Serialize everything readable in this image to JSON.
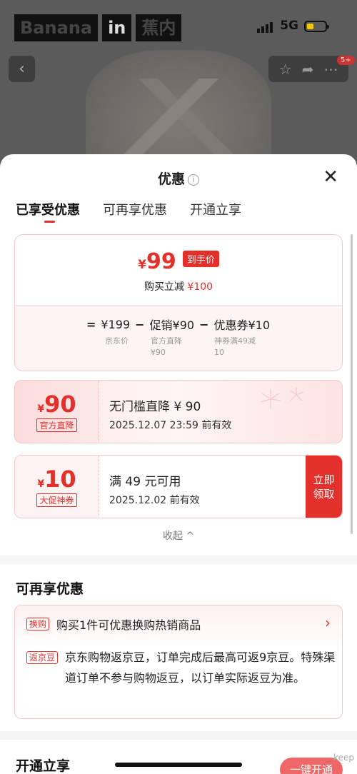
{
  "status_bar": {
    "brand": [
      "Banana",
      "in",
      "蕉内"
    ],
    "network": "5G"
  },
  "product_nav": {
    "cart_badge": "5+"
  },
  "sheet": {
    "title": "优惠",
    "tabs": [
      "已享受优惠",
      "可再享优惠",
      "开通立享"
    ],
    "summary": {
      "final_yen": "¥",
      "final_price": "99",
      "final_tag": "到手价",
      "reduce_label": "购买立减",
      "reduce_amount": "¥100",
      "eq_sign": "=",
      "base_price": "¥199",
      "minus1": "−",
      "promo": "促销¥90",
      "minus2": "−",
      "coupon": "优惠券¥10",
      "base_label": "京东价",
      "promo_label": "官方直降\n¥90",
      "coupon_label": "神券满49减\n10"
    },
    "coupons": [
      {
        "yen": "¥",
        "amount": "90",
        "tag": "官方直降",
        "title": "无门槛直降 ¥ 90",
        "date": "2025.12.07 23:59 前有效"
      },
      {
        "yen": "¥",
        "amount": "10",
        "tag": "大促神券",
        "title": "满 49 元可用",
        "date": "2025.12.02 前有效",
        "action": "立即\n领取"
      }
    ],
    "collapse": "收起 ^",
    "more": {
      "title": "可再享优惠",
      "items": [
        {
          "tag": "换购",
          "text": "购买1件可优惠换购热销商品"
        },
        {
          "tag": "返京豆",
          "text": "京东购物返京豆，订单完成后最高可返9京豆。特殊渠道订单不参与购物返豆，以订单实际返豆为准。"
        }
      ]
    },
    "open": {
      "title": "开通立享",
      "button": "一键开通"
    },
    "watermark": "keep"
  },
  "colors": {
    "accent": "#e4302b",
    "card_border": "#f2c9c9"
  }
}
